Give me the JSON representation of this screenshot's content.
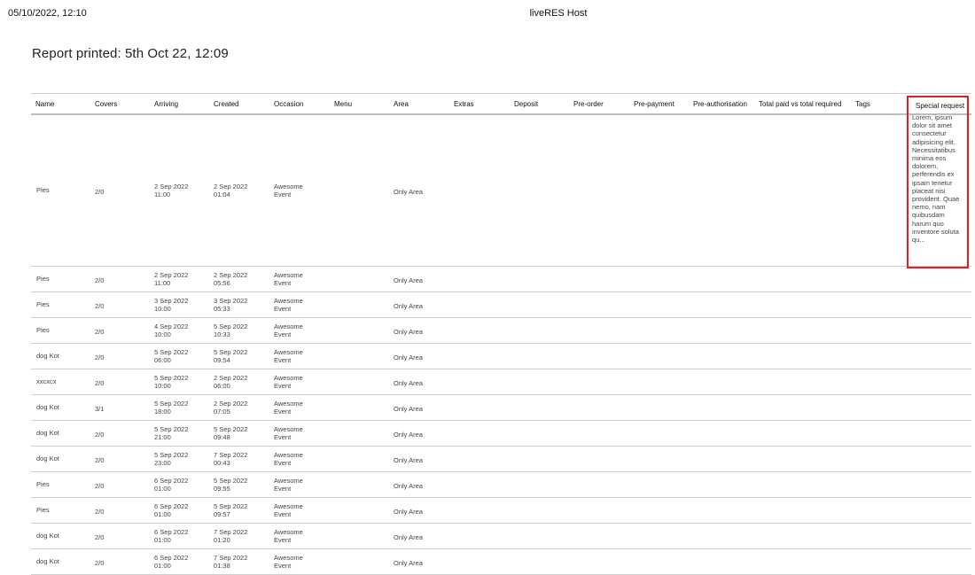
{
  "print_header": {
    "date": "05/10/2022, 12:10",
    "title": "liveRES Host"
  },
  "report": {
    "title": "Report printed: 5th Oct 22, 12:09"
  },
  "columns": [
    {
      "key": "name",
      "label": "Name"
    },
    {
      "key": "covers",
      "label": "Covers"
    },
    {
      "key": "arriving",
      "label": "Arriving"
    },
    {
      "key": "created",
      "label": "Created"
    },
    {
      "key": "occasion",
      "label": "Occasion"
    },
    {
      "key": "menu",
      "label": "Menu"
    },
    {
      "key": "area",
      "label": "Area"
    },
    {
      "key": "extras",
      "label": "Extras"
    },
    {
      "key": "deposit",
      "label": "Deposit"
    },
    {
      "key": "preorder",
      "label": "Pre-order"
    },
    {
      "key": "prepayment",
      "label": "Pre-payment"
    },
    {
      "key": "preauth",
      "label": "Pre-authorisation"
    },
    {
      "key": "totalpaid",
      "label": "Total paid vs total required"
    },
    {
      "key": "tags",
      "label": "Tags"
    },
    {
      "key": "special",
      "label": "Special request"
    }
  ],
  "rows": [
    {
      "name": "Pies",
      "covers": "2/0",
      "arriving_date": "2 Sep 2022",
      "arriving_time": "11:00",
      "created_date": "2 Sep 2022",
      "created_time": "01:04",
      "occasion_1": "Awesome",
      "occasion_2": "Event",
      "area": "Only Area",
      "special": "Lorem, ipsum dolor sit amet consectetur adipisicing elit. Necessitatibus minima eos dolorem, perferendis ex ipsam tenetur placeat nisi provident. Quae nemo, nam quibusdam harum quo inventore soluta qu..."
    },
    {
      "name": "Pies",
      "covers": "2/0",
      "arriving_date": "2 Sep 2022",
      "arriving_time": "11:00",
      "created_date": "2 Sep 2022",
      "created_time": "05:56",
      "occasion_1": "Awesome",
      "occasion_2": "Event",
      "area": "Only Area"
    },
    {
      "name": "Pies",
      "covers": "2/0",
      "arriving_date": "3 Sep 2022",
      "arriving_time": "10:00",
      "created_date": "3 Sep 2022",
      "created_time": "05:33",
      "occasion_1": "Awesome",
      "occasion_2": "Event",
      "area": "Only Area"
    },
    {
      "name": "Pies",
      "covers": "2/0",
      "arriving_date": "4 Sep 2022",
      "arriving_time": "10:00",
      "created_date": "5 Sep 2022",
      "created_time": "10:33",
      "occasion_1": "Awesome",
      "occasion_2": "Event",
      "area": "Only Area"
    },
    {
      "name": "dog Kot",
      "covers": "2/0",
      "arriving_date": "5 Sep 2022",
      "arriving_time": "06:00",
      "created_date": "5 Sep 2022",
      "created_time": "09:54",
      "occasion_1": "Awesome",
      "occasion_2": "Event",
      "area": "Only Area"
    },
    {
      "name": "xxcxcx",
      "covers": "2/0",
      "arriving_date": "5 Sep 2022",
      "arriving_time": "10:00",
      "created_date": "2 Sep 2022",
      "created_time": "06:00",
      "occasion_1": "Awesome",
      "occasion_2": "Event",
      "area": "Only Area"
    },
    {
      "name": "dog Kot",
      "covers": "3/1",
      "arriving_date": "5 Sep 2022",
      "arriving_time": "18:00",
      "created_date": "2 Sep 2022",
      "created_time": "07:05",
      "occasion_1": "Awesome",
      "occasion_2": "Event",
      "area": "Only Area"
    },
    {
      "name": "dog Kot",
      "covers": "2/0",
      "arriving_date": "5 Sep 2022",
      "arriving_time": "21:00",
      "created_date": "5 Sep 2022",
      "created_time": "09:48",
      "occasion_1": "Awesome",
      "occasion_2": "Event",
      "area": "Only Area"
    },
    {
      "name": "dog Kot",
      "covers": "2/0",
      "arriving_date": "5 Sep 2022",
      "arriving_time": "23:00",
      "created_date": "7 Sep 2022",
      "created_time": "00:43",
      "occasion_1": "Awesome",
      "occasion_2": "Event",
      "area": "Only Area"
    },
    {
      "name": "Pies",
      "covers": "2/0",
      "arriving_date": "6 Sep 2022",
      "arriving_time": "01:00",
      "created_date": "5 Sep 2022",
      "created_time": "09:55",
      "occasion_1": "Awesome",
      "occasion_2": "Event",
      "area": "Only Area"
    },
    {
      "name": "Pies",
      "covers": "2/0",
      "arriving_date": "6 Sep 2022",
      "arriving_time": "01:00",
      "created_date": "5 Sep 2022",
      "created_time": "09:57",
      "occasion_1": "Awesome",
      "occasion_2": "Event",
      "area": "Only Area"
    },
    {
      "name": "dog Kot",
      "covers": "2/0",
      "arriving_date": "6 Sep 2022",
      "arriving_time": "01:00",
      "created_date": "7 Sep 2022",
      "created_time": "01:20",
      "occasion_1": "Awesome",
      "occasion_2": "Event",
      "area": "Only Area"
    },
    {
      "name": "dog Kot",
      "covers": "2/0",
      "arriving_date": "6 Sep 2022",
      "arriving_time": "01:00",
      "created_date": "7 Sep 2022",
      "created_time": "01:38",
      "occasion_1": "Awesome",
      "occasion_2": "Event",
      "area": "Only Area"
    }
  ],
  "highlight": {
    "color": "#e31b23"
  }
}
